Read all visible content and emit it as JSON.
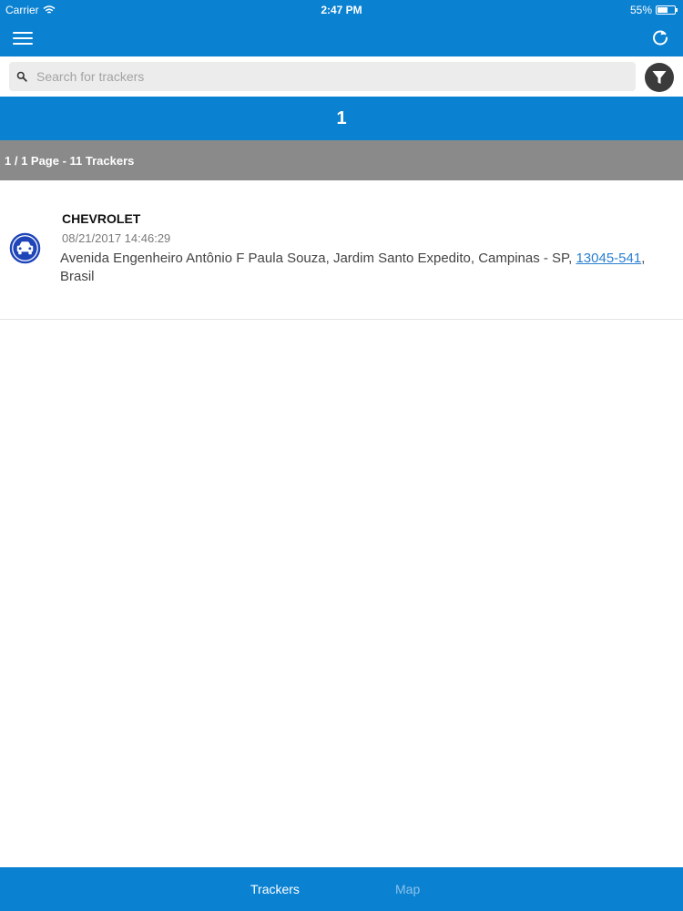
{
  "status_bar": {
    "carrier": "Carrier",
    "time": "2:47 PM",
    "battery": "55%",
    "battery_level": 0.55
  },
  "search": {
    "placeholder": "Search for trackers"
  },
  "pagination": {
    "current_page": "1",
    "summary": "1 / 1 Page - 11 Trackers"
  },
  "trackers": [
    {
      "name": "CHEVROLET",
      "datetime": "08/21/2017 14:46:29",
      "address_text": "Avenida Engenheiro Antônio F Paula Souza, Jardim Santo Expedito, Campinas - SP, ",
      "postal_code": "13045-541",
      "address_suffix": ", Brasil",
      "icon": "car-icon"
    }
  ],
  "tabs": [
    {
      "label": "Trackers",
      "active": true
    },
    {
      "label": "Map",
      "active": false
    }
  ],
  "colors": {
    "primary": "#0a81d1",
    "summary_band": "#8a8a8a",
    "link": "#2a7fd0",
    "inactive_tab": "#8cc3ea"
  },
  "icons": {
    "menu": "hamburger-menu-icon",
    "refresh": "refresh-icon",
    "search": "search-icon",
    "filter": "filter-icon",
    "wifi": "wifi-icon",
    "battery": "battery-icon"
  }
}
